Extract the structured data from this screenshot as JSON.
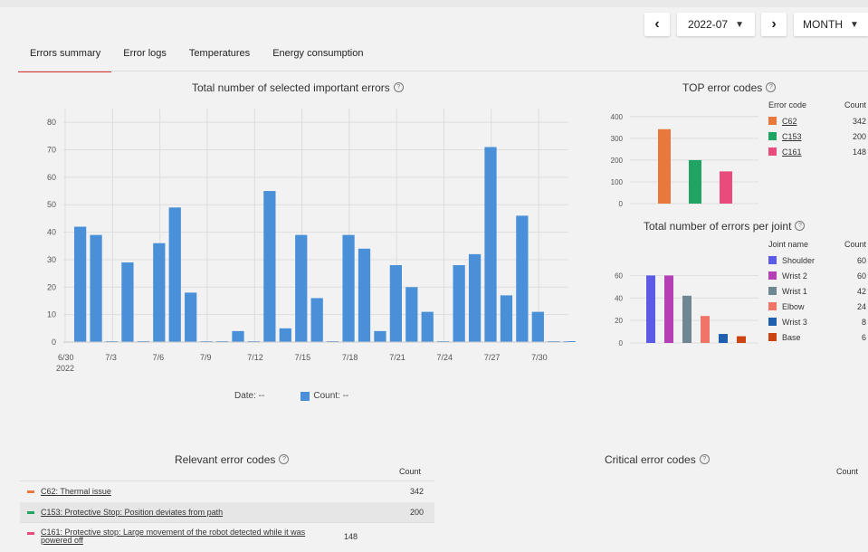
{
  "controls": {
    "prev_label": "‹",
    "period_value": "2022-07",
    "next_label": "›",
    "granularity_value": "MONTH"
  },
  "tabs": [
    "Errors summary",
    "Error logs",
    "Temperatures",
    "Energy consumption"
  ],
  "main_chart": {
    "title": "Total number of selected important errors",
    "help": "?",
    "footer_date": "Date: --",
    "footer_count": "Count: --"
  },
  "top_chart": {
    "title": "TOP error codes",
    "help": "?",
    "legend_header_name": "Error code",
    "legend_header_count": "Count"
  },
  "joint_chart": {
    "title": "Total number of errors per joint",
    "help": "?",
    "legend_header_name": "Joint name",
    "legend_header_count": "Count"
  },
  "relevant": {
    "title": "Relevant error codes",
    "help": "?",
    "count_header": "Count",
    "rows": [
      {
        "label": "C62: Thermal issue",
        "count": "342",
        "color": "#e8783c"
      },
      {
        "label": "C153: Protective Stop: Position deviates from path",
        "count": "200",
        "color": "#1fa463"
      },
      {
        "label": "C161: Protective stop: Large movement of the robot detected while it was powered off",
        "count": "148",
        "color": "#e94b7c"
      }
    ]
  },
  "critical": {
    "title": "Critical error codes",
    "help": "?",
    "count_header": "Count"
  },
  "chart_data": [
    {
      "type": "bar",
      "title": "Total number of selected important errors",
      "x": [
        "6/30",
        "7/1",
        "7/2",
        "7/3",
        "7/4",
        "7/5",
        "7/6",
        "7/7",
        "7/8",
        "7/9",
        "7/10",
        "7/11",
        "7/12",
        "7/13",
        "7/14",
        "7/15",
        "7/16",
        "7/17",
        "7/18",
        "7/19",
        "7/20",
        "7/21",
        "7/22",
        "7/23",
        "7/24",
        "7/25",
        "7/26",
        "7/27",
        "7/28",
        "7/29",
        "7/30",
        "7/31"
      ],
      "xtick_labels": [
        "6/30",
        "7/3",
        "7/6",
        "7/9",
        "7/12",
        "7/15",
        "7/18",
        "7/21",
        "7/24",
        "7/27",
        "7/30"
      ],
      "xtick_sublabel": "2022",
      "values": [
        42,
        39,
        0,
        29,
        0,
        36,
        49,
        18,
        0,
        0,
        4,
        0,
        55,
        5,
        39,
        16,
        0,
        39,
        34,
        4,
        28,
        20,
        11,
        0,
        28,
        32,
        71,
        17,
        46,
        11,
        0,
        0
      ],
      "ylim": [
        0,
        85
      ],
      "yticks": [
        0,
        10,
        20,
        30,
        40,
        50,
        60,
        70,
        80
      ],
      "color": "#4a90d9",
      "grid": true
    },
    {
      "type": "bar",
      "title": "TOP error codes",
      "categories": [
        "C62",
        "C153",
        "C161"
      ],
      "values": [
        342,
        200,
        148
      ],
      "colors": [
        "#e8783c",
        "#1fa463",
        "#e94b7c"
      ],
      "ylim": [
        0,
        420
      ],
      "yticks": [
        0,
        100,
        200,
        300,
        400
      ],
      "legend": "right",
      "grid": true
    },
    {
      "type": "bar",
      "title": "Total number of errors per joint",
      "categories": [
        "Shoulder",
        "Wrist 2",
        "Wrist 1",
        "Elbow",
        "Wrist 3",
        "Base"
      ],
      "values": [
        60,
        60,
        42,
        24,
        8,
        6
      ],
      "colors": [
        "#5b5be6",
        "#b53fb5",
        "#6e8793",
        "#f07468",
        "#1f5fae",
        "#cc4412"
      ],
      "ylim": [
        0,
        70
      ],
      "yticks": [
        0,
        20,
        40,
        60
      ],
      "legend": "right",
      "grid": true
    }
  ]
}
